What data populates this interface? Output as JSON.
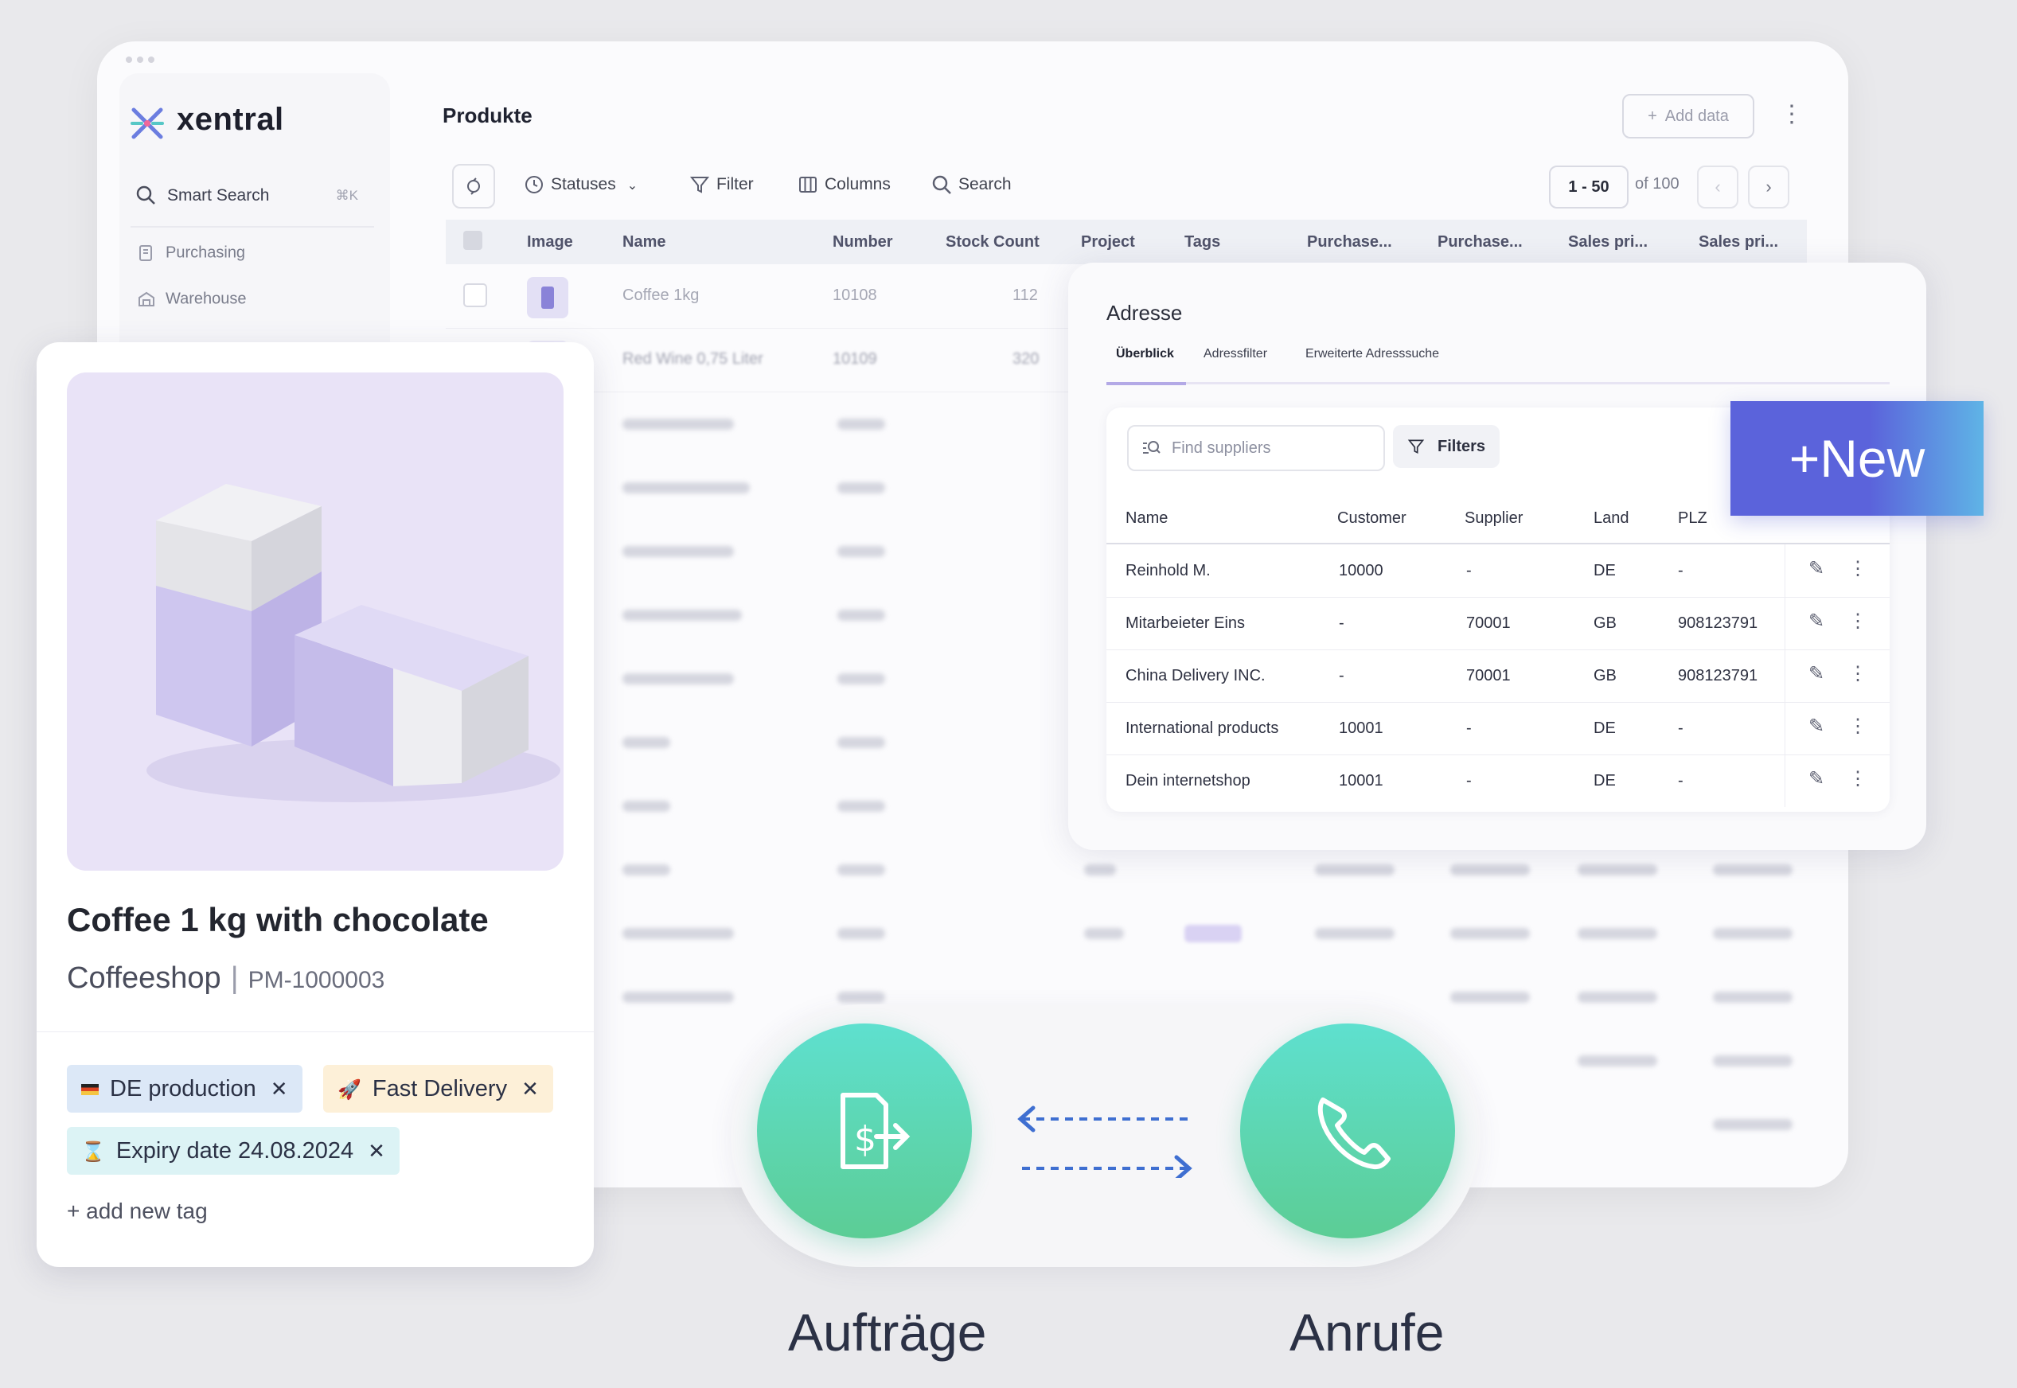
{
  "app": {
    "logo": "xentral"
  },
  "sidebar": {
    "search": {
      "label": "Smart Search",
      "shortcut": "⌘K"
    },
    "items": [
      {
        "label": "Purchasing"
      },
      {
        "label": "Warehouse"
      }
    ]
  },
  "main": {
    "title": "Produkte",
    "add_label": "Add data",
    "toolbar": {
      "statuses": "Statuses",
      "filter": "Filter",
      "columns": "Columns",
      "search": "Search"
    },
    "pager": {
      "range": "1 - 50",
      "total": "of 100",
      "prev": "‹",
      "next": "›"
    },
    "columns": [
      "Image",
      "Name",
      "Number",
      "Stock Count",
      "Project",
      "Tags",
      "Purchase...",
      "Purchase...",
      "Sales pri...",
      "Sales pri..."
    ],
    "rows": [
      {
        "name": "Coffee 1kg",
        "number": "10108",
        "stock": "112"
      },
      {
        "name": "Red Wine 0,75 Liter",
        "number": "10109",
        "stock": "320"
      }
    ]
  },
  "address": {
    "title": "Adresse",
    "tabs": [
      "Überblick",
      "Adressfilter",
      "Erweiterte Adresssuche"
    ],
    "search_placeholder": "Find suppliers",
    "filters_label": "Filters",
    "columns": [
      "Name",
      "Customer",
      "Supplier",
      "Land",
      "PLZ"
    ],
    "rows": [
      {
        "name": "Reinhold M.",
        "customer": "10000",
        "supplier": "-",
        "land": "DE",
        "plz": "-"
      },
      {
        "name": "Mitarbeieter Eins",
        "customer": "-",
        "supplier": "70001",
        "land": "GB",
        "plz": "908123791"
      },
      {
        "name": "China Delivery INC.",
        "customer": "-",
        "supplier": "70001",
        "land": "GB",
        "plz": "908123791"
      },
      {
        "name": "International products",
        "customer": "10001",
        "supplier": "-",
        "land": "DE",
        "plz": "-"
      },
      {
        "name": "Dein internetshop",
        "customer": "10001",
        "supplier": "-",
        "land": "DE",
        "plz": "-"
      }
    ]
  },
  "new_button": {
    "label": "New"
  },
  "product": {
    "title": "Coffee 1 kg with chocolate",
    "shop": "Coffeeshop",
    "code": "PM-1000003",
    "tags": [
      {
        "label": "DE production",
        "bg": "#dce8f7"
      },
      {
        "label": "Fast Delivery",
        "bg": "#fdf0d8"
      },
      {
        "label": "Expiry date 24.08.2024",
        "bg": "#dcf3f5"
      }
    ],
    "add_tag": "+ add new tag"
  },
  "bottom": {
    "left_label": "Aufträge",
    "right_label": "Anrufe"
  },
  "colors": {
    "accent": "#5b63db",
    "green": "#5cd5ab",
    "arrow": "#3f6fd1"
  }
}
